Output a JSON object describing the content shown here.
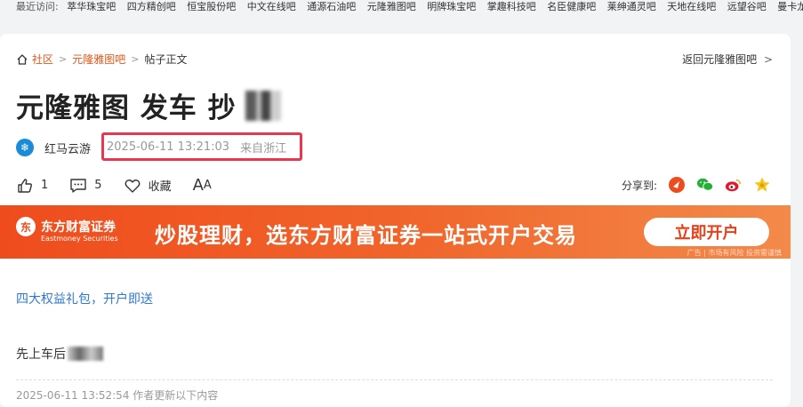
{
  "recent": {
    "label": "最近访问:",
    "items": [
      "萃华珠宝吧",
      "四方精创吧",
      "恒宝股份吧",
      "中文在线吧",
      "通源石油吧",
      "元隆雅图吧",
      "明牌珠宝吧",
      "掌趣科技吧",
      "名臣健康吧",
      "莱绅通灵吧",
      "天地在线吧",
      "远望谷吧",
      "曼卡龙"
    ]
  },
  "breadcrumb": {
    "home": "社区",
    "bar": "元隆雅图吧",
    "current": "帖子正文"
  },
  "back_link": "返回元隆雅图吧",
  "post": {
    "title": "元隆雅图 发车 抄",
    "author": "红马云游",
    "time": "2025-06-11 13:21:03",
    "location": "来自浙江",
    "likes": "1",
    "comments": "5",
    "favorite_label": "收藏",
    "font_label_big": "A",
    "font_label_small": "A",
    "share_label": "分享到:"
  },
  "banner": {
    "brand_cn": "东方财富证券",
    "brand_en": "Eastmoney Securities",
    "logo_char": "东",
    "slogan": "炒股理财，选东方财富证券一站式开户交易",
    "button": "立即开户",
    "ad_tag": "广告 | 市场有风险 投资需谨慎"
  },
  "content": {
    "promo_link": "四大权益礼包，开户即送",
    "line1": "先上车后",
    "update": "2025-06-11 13:52:54  作者更新以下内容"
  },
  "colors": {
    "accent": "#e0561b",
    "link": "#2f78d4",
    "highlight_box": "#e8384f",
    "banner": "#ef4c1d"
  }
}
